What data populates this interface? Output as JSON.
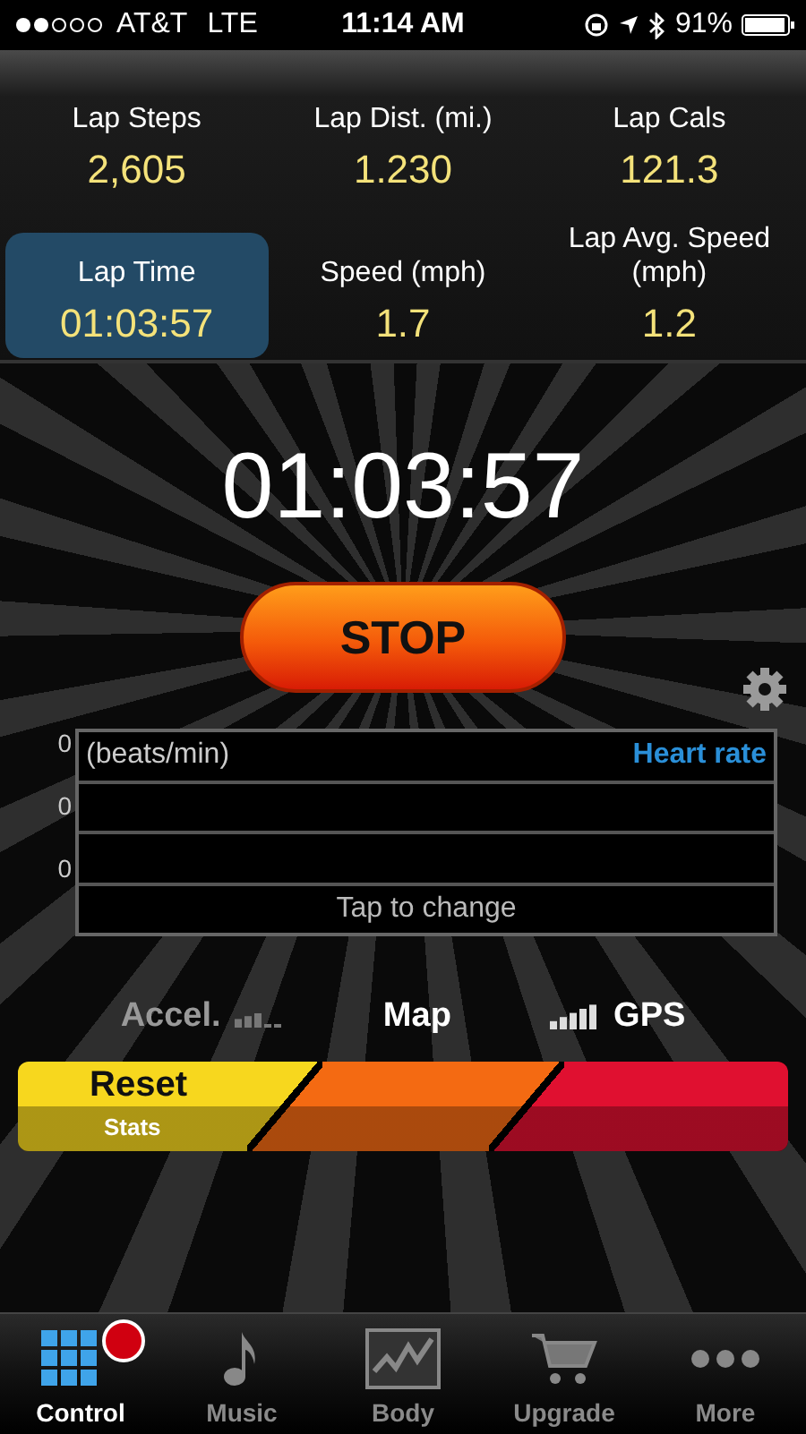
{
  "status_bar": {
    "carrier": "AT&T",
    "network": "LTE",
    "time": "11:14 AM",
    "battery": "91%"
  },
  "stats": [
    {
      "label": "Lap Steps",
      "value": "2,605",
      "selected": false
    },
    {
      "label": "Lap Dist. (mi.)",
      "value": "1.230",
      "selected": false
    },
    {
      "label": "Lap Cals",
      "value": "121.3",
      "selected": false
    },
    {
      "label": "Lap Time",
      "value": "01:03:57",
      "selected": true
    },
    {
      "label": "Speed (mph)",
      "value": "1.7",
      "selected": false
    },
    {
      "label": "Lap Avg. Speed (mph)",
      "value": "1.2",
      "selected": false
    }
  ],
  "timer": "01:03:57",
  "stop_button": "STOP",
  "heart_panel": {
    "y_labels": [
      "0",
      "0",
      "0"
    ],
    "unit": "(beats/min)",
    "series": "Heart rate",
    "hint": "Tap to change"
  },
  "sensors": [
    {
      "label": "Accel.",
      "kind": "signal-after",
      "active": false
    },
    {
      "label": "Map",
      "kind": "plain",
      "active": true
    },
    {
      "label": "GPS",
      "kind": "signal-before",
      "active": true
    }
  ],
  "segments": [
    {
      "label": "Reset",
      "sublabel": "Stats",
      "color": "#f7d71e"
    },
    {
      "color": "#f46a12"
    },
    {
      "color": "#e01030"
    }
  ],
  "tabs": [
    {
      "label": "Control",
      "kind": "grid",
      "selected": true,
      "badge": true
    },
    {
      "label": "Music",
      "kind": "note",
      "selected": false,
      "badge": false
    },
    {
      "label": "Body",
      "kind": "chart",
      "selected": false,
      "badge": false
    },
    {
      "label": "Upgrade",
      "kind": "cart",
      "selected": false,
      "badge": false
    },
    {
      "label": "More",
      "kind": "dots",
      "selected": false,
      "badge": false
    }
  ]
}
